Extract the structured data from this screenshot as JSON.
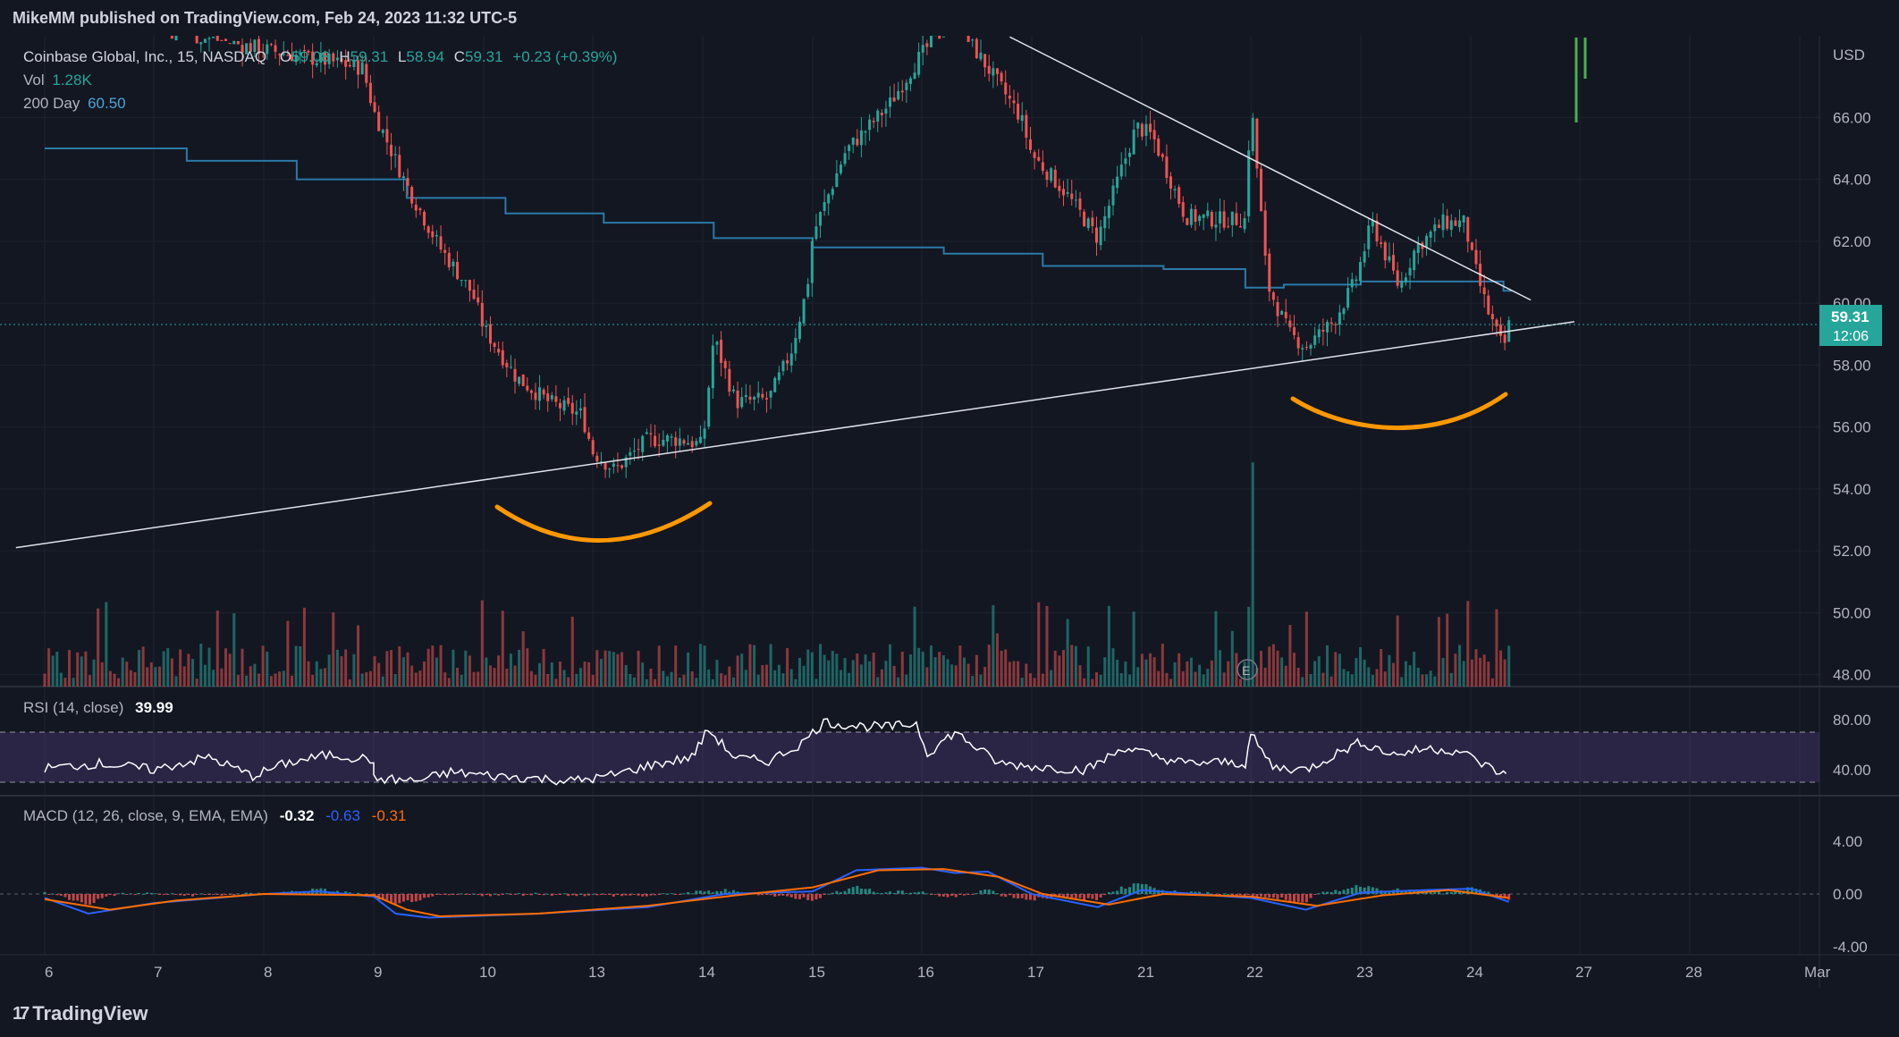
{
  "header": {
    "published": "MikeMM published on TradingView.com, Feb 24, 2023 11:32 UTC-5"
  },
  "legend": {
    "symbol": "Coinbase Global, Inc., 15, NASDAQ",
    "open_label": "O",
    "open": "59.08",
    "high_label": "H",
    "high": "59.31",
    "low_label": "L",
    "low": "58.94",
    "close_label": "C",
    "close": "59.31",
    "change": "+0.23 (+0.39%)",
    "vol_label": "Vol",
    "vol": "1.28K",
    "ma_label": "200 Day",
    "ma": "60.50"
  },
  "rsi_legend": {
    "label": "RSI (14, close)",
    "value": "39.99"
  },
  "macd_legend": {
    "label": "MACD (12, 26, close, 9, EMA, EMA)",
    "macd": "-0.32",
    "signal": "-0.63",
    "hist": "-0.31"
  },
  "footer": {
    "brand": "TradingView",
    "mark": "17"
  },
  "price_tag": {
    "price": "59.31",
    "time": "12:06"
  },
  "colors": {
    "up": "#26a69a",
    "down": "#ef5350",
    "ma": "#2a7aa8",
    "rsi": "#ffffff",
    "rsi_band": "#7e57c2",
    "macd": "#2962ff",
    "signal": "#ff6d00",
    "annotation": "#ff9800",
    "bg": "#131722",
    "grid": "#1f2330"
  },
  "chart_data": [
    {
      "type": "candlestick",
      "currency_label": "USD",
      "ylim": [
        47.5,
        68.5
      ],
      "y_ticks": [
        "48.00",
        "50.00",
        "52.00",
        "54.00",
        "56.00",
        "58.00",
        "60.00",
        "62.00",
        "64.00",
        "66.00"
      ],
      "x_ticks": [
        "6",
        "7",
        "8",
        "9",
        "10",
        "13",
        "14",
        "15",
        "16",
        "17",
        "21",
        "22",
        "23",
        "24",
        "27",
        "28",
        "Mar"
      ],
      "close_path": [
        [
          0,
          69.5
        ],
        [
          1.0,
          68.9
        ],
        [
          2.0,
          68.2
        ],
        [
          2.9,
          67.6
        ],
        [
          3.0,
          66.2
        ],
        [
          3.3,
          63.8
        ],
        [
          3.6,
          61.8
        ],
        [
          3.9,
          60.3
        ],
        [
          4.0,
          59.2
        ],
        [
          4.3,
          57.6
        ],
        [
          4.6,
          56.8
        ],
        [
          4.9,
          56.4
        ],
        [
          5.0,
          55.2
        ],
        [
          5.2,
          54.6
        ],
        [
          5.5,
          55.6
        ],
        [
          5.8,
          55.6
        ],
        [
          6.0,
          55.4
        ],
        [
          6.1,
          58.9
        ],
        [
          6.3,
          56.8
        ],
        [
          6.6,
          56.9
        ],
        [
          6.8,
          58.4
        ],
        [
          6.95,
          60.5
        ],
        [
          7.0,
          62.2
        ],
        [
          7.3,
          64.9
        ],
        [
          7.7,
          66.4
        ],
        [
          7.95,
          67.8
        ],
        [
          8.1,
          68.5
        ],
        [
          8.3,
          69.1
        ],
        [
          8.6,
          67.6
        ],
        [
          8.9,
          66.0
        ],
        [
          9.0,
          64.8
        ],
        [
          9.3,
          63.6
        ],
        [
          9.6,
          62.1
        ],
        [
          9.95,
          65.7
        ],
        [
          10.1,
          65.4
        ],
        [
          10.4,
          62.8
        ],
        [
          10.7,
          62.7
        ],
        [
          10.95,
          62.7
        ],
        [
          11.0,
          66.6
        ],
        [
          11.15,
          60.6
        ],
        [
          11.35,
          59.0
        ],
        [
          11.5,
          58.6
        ],
        [
          11.75,
          59.4
        ],
        [
          11.95,
          60.7
        ],
        [
          12.1,
          62.6
        ],
        [
          12.35,
          60.5
        ],
        [
          12.5,
          61.8
        ],
        [
          12.75,
          62.6
        ],
        [
          12.95,
          62.6
        ],
        [
          13.0,
          61.6
        ],
        [
          13.15,
          59.8
        ],
        [
          13.3,
          58.5
        ],
        [
          13.35,
          59.3
        ]
      ],
      "support_line": {
        "from": [
          -0.1,
          52.1
        ],
        "to": [
          13.95,
          59.4
        ]
      },
      "resistance_line": {
        "from": [
          8.8,
          68.6
        ],
        "to": [
          13.55,
          60.1
        ]
      },
      "ma_200_steps": [
        [
          0,
          65.0
        ],
        [
          1.3,
          64.6
        ],
        [
          2.3,
          64.0
        ],
        [
          3.3,
          63.4
        ],
        [
          4.2,
          62.9
        ],
        [
          5.1,
          62.6
        ],
        [
          6.1,
          62.1
        ],
        [
          7.0,
          61.8
        ],
        [
          8.2,
          61.6
        ],
        [
          9.1,
          61.2
        ],
        [
          10.2,
          61.1
        ],
        [
          10.95,
          60.5
        ],
        [
          11.3,
          60.6
        ],
        [
          12.0,
          60.7
        ],
        [
          13.3,
          60.4
        ]
      ],
      "last_price": 59.31
    },
    {
      "type": "line",
      "name": "RSI (14, close)",
      "ylim": [
        20,
        90
      ],
      "y_ticks": [
        "80.00",
        "40.00"
      ],
      "band": [
        30,
        70
      ],
      "values": [
        [
          0,
          41
        ],
        [
          0.5,
          45
        ],
        [
          1.0,
          40
        ],
        [
          1.5,
          50
        ],
        [
          1.9,
          35
        ],
        [
          2.2,
          45
        ],
        [
          2.6,
          52
        ],
        [
          3.0,
          48
        ],
        [
          3.0,
          33
        ],
        [
          3.4,
          31
        ],
        [
          3.7,
          38
        ],
        [
          4.1,
          35
        ],
        [
          4.5,
          33
        ],
        [
          4.8,
          31
        ],
        [
          5.1,
          34
        ],
        [
          5.5,
          43
        ],
        [
          5.9,
          50
        ],
        [
          6.05,
          72
        ],
        [
          6.3,
          49
        ],
        [
          6.6,
          47
        ],
        [
          6.9,
          61
        ],
        [
          7.1,
          78
        ],
        [
          7.4,
          75
        ],
        [
          7.7,
          74
        ],
        [
          7.95,
          77
        ],
        [
          8.05,
          53
        ],
        [
          8.3,
          70
        ],
        [
          8.7,
          45
        ],
        [
          9.1,
          42
        ],
        [
          9.5,
          40
        ],
        [
          9.85,
          58
        ],
        [
          10.1,
          51
        ],
        [
          10.4,
          45
        ],
        [
          10.7,
          46
        ],
        [
          10.95,
          45
        ],
        [
          11.0,
          68
        ],
        [
          11.2,
          42
        ],
        [
          11.5,
          40
        ],
        [
          11.85,
          56
        ],
        [
          12.0,
          62
        ],
        [
          12.3,
          52
        ],
        [
          12.6,
          57
        ],
        [
          12.9,
          55
        ],
        [
          13.1,
          45
        ],
        [
          13.3,
          36
        ],
        [
          13.35,
          40
        ]
      ]
    },
    {
      "type": "line",
      "name": "MACD (12, 26, close, 9, EMA, EMA)",
      "ylim": [
        -4.2,
        5.2
      ],
      "y_ticks": [
        "4.00",
        "0.00",
        "-4.00"
      ],
      "series": [
        {
          "values": [
            [
              0,
              -0.3
            ],
            [
              0.4,
              -1.5
            ],
            [
              1.0,
              -0.7
            ],
            [
              2.0,
              0.0
            ],
            [
              2.5,
              0.2
            ],
            [
              3.0,
              -0.2
            ],
            [
              3.2,
              -1.5
            ],
            [
              3.5,
              -1.8
            ],
            [
              4.5,
              -1.5
            ],
            [
              5.5,
              -1.0
            ],
            [
              6.2,
              0.0
            ],
            [
              7.0,
              0.2
            ],
            [
              7.4,
              1.8
            ],
            [
              8.0,
              2.0
            ],
            [
              8.3,
              1.6
            ],
            [
              8.6,
              1.7
            ],
            [
              9.0,
              0.0
            ],
            [
              9.6,
              -1.0
            ],
            [
              10.0,
              0.3
            ],
            [
              10.8,
              -0.2
            ],
            [
              11.0,
              -0.3
            ],
            [
              11.5,
              -1.2
            ],
            [
              12.0,
              0.1
            ],
            [
              12.6,
              0.3
            ],
            [
              13.0,
              0.4
            ],
            [
              13.35,
              -0.6
            ]
          ]
        },
        {
          "values": [
            [
              0,
              -0.4
            ],
            [
              0.6,
              -1.2
            ],
            [
              1.2,
              -0.5
            ],
            [
              2.0,
              0.0
            ],
            [
              3.0,
              -0.1
            ],
            [
              3.3,
              -1.2
            ],
            [
              3.6,
              -1.7
            ],
            [
              4.5,
              -1.5
            ],
            [
              5.5,
              -0.9
            ],
            [
              6.3,
              -0.1
            ],
            [
              7.0,
              0.5
            ],
            [
              7.6,
              1.8
            ],
            [
              8.2,
              1.9
            ],
            [
              8.7,
              1.3
            ],
            [
              9.1,
              0.0
            ],
            [
              9.7,
              -0.8
            ],
            [
              10.2,
              0.0
            ],
            [
              11.0,
              -0.2
            ],
            [
              11.6,
              -0.9
            ],
            [
              12.2,
              -0.1
            ],
            [
              12.8,
              0.3
            ],
            [
              13.35,
              -0.3
            ]
          ]
        }
      ]
    }
  ]
}
